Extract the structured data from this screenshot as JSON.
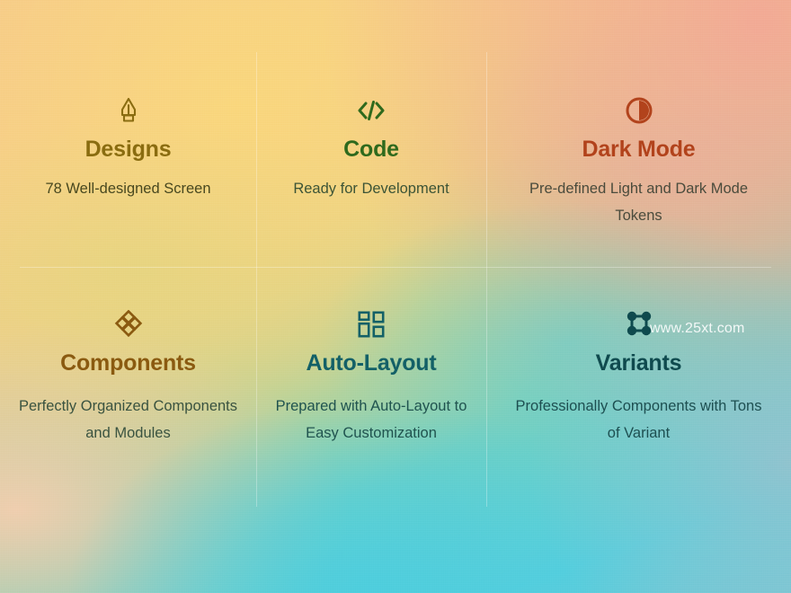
{
  "background": {
    "top_left_color": "#f5c98a",
    "top_right_color": "#efae99",
    "bottom_left_color": "#f3cdae",
    "bottom_center_color": "#56cede",
    "bottom_right_color": "#9ec4cd",
    "mid_color": "#a9d2a0"
  },
  "watermark": {
    "text": "www.25xt.com",
    "color": "#ffffff"
  },
  "features": [
    {
      "id": "designs",
      "icon": "pen-nib-icon",
      "title": "Designs",
      "title_color": "#8a6c10",
      "description": "78 Well-designed Screen",
      "description_color": "#48481f"
    },
    {
      "id": "code",
      "icon": "code-brackets-icon",
      "title": "Code",
      "title_color": "#2f6a1d",
      "description": "Ready for Development",
      "description_color": "#3c5436"
    },
    {
      "id": "dark-mode",
      "icon": "contrast-circle-icon",
      "title": "Dark Mode",
      "title_color": "#b2431c",
      "description": "Pre-defined Light and Dark Mode Tokens",
      "description_color": "#4a4b3c"
    },
    {
      "id": "components",
      "icon": "four-diamonds-icon",
      "title": "Components",
      "title_color": "#8a5a10",
      "description": "Perfectly Organized Components and Modules",
      "description_color": "#3a5340"
    },
    {
      "id": "auto-layout",
      "icon": "four-squares-grid-icon",
      "title": "Auto-Layout",
      "title_color": "#136067",
      "description": "Prepared with Auto-Layout to Easy Customization",
      "description_color": "#20534f"
    },
    {
      "id": "variants",
      "icon": "variants-nodes-icon",
      "title": "Variants",
      "title_color": "#0f4a4e",
      "description": "Professionally Components with Tons of Variant",
      "description_color": "#1d4f51"
    }
  ]
}
